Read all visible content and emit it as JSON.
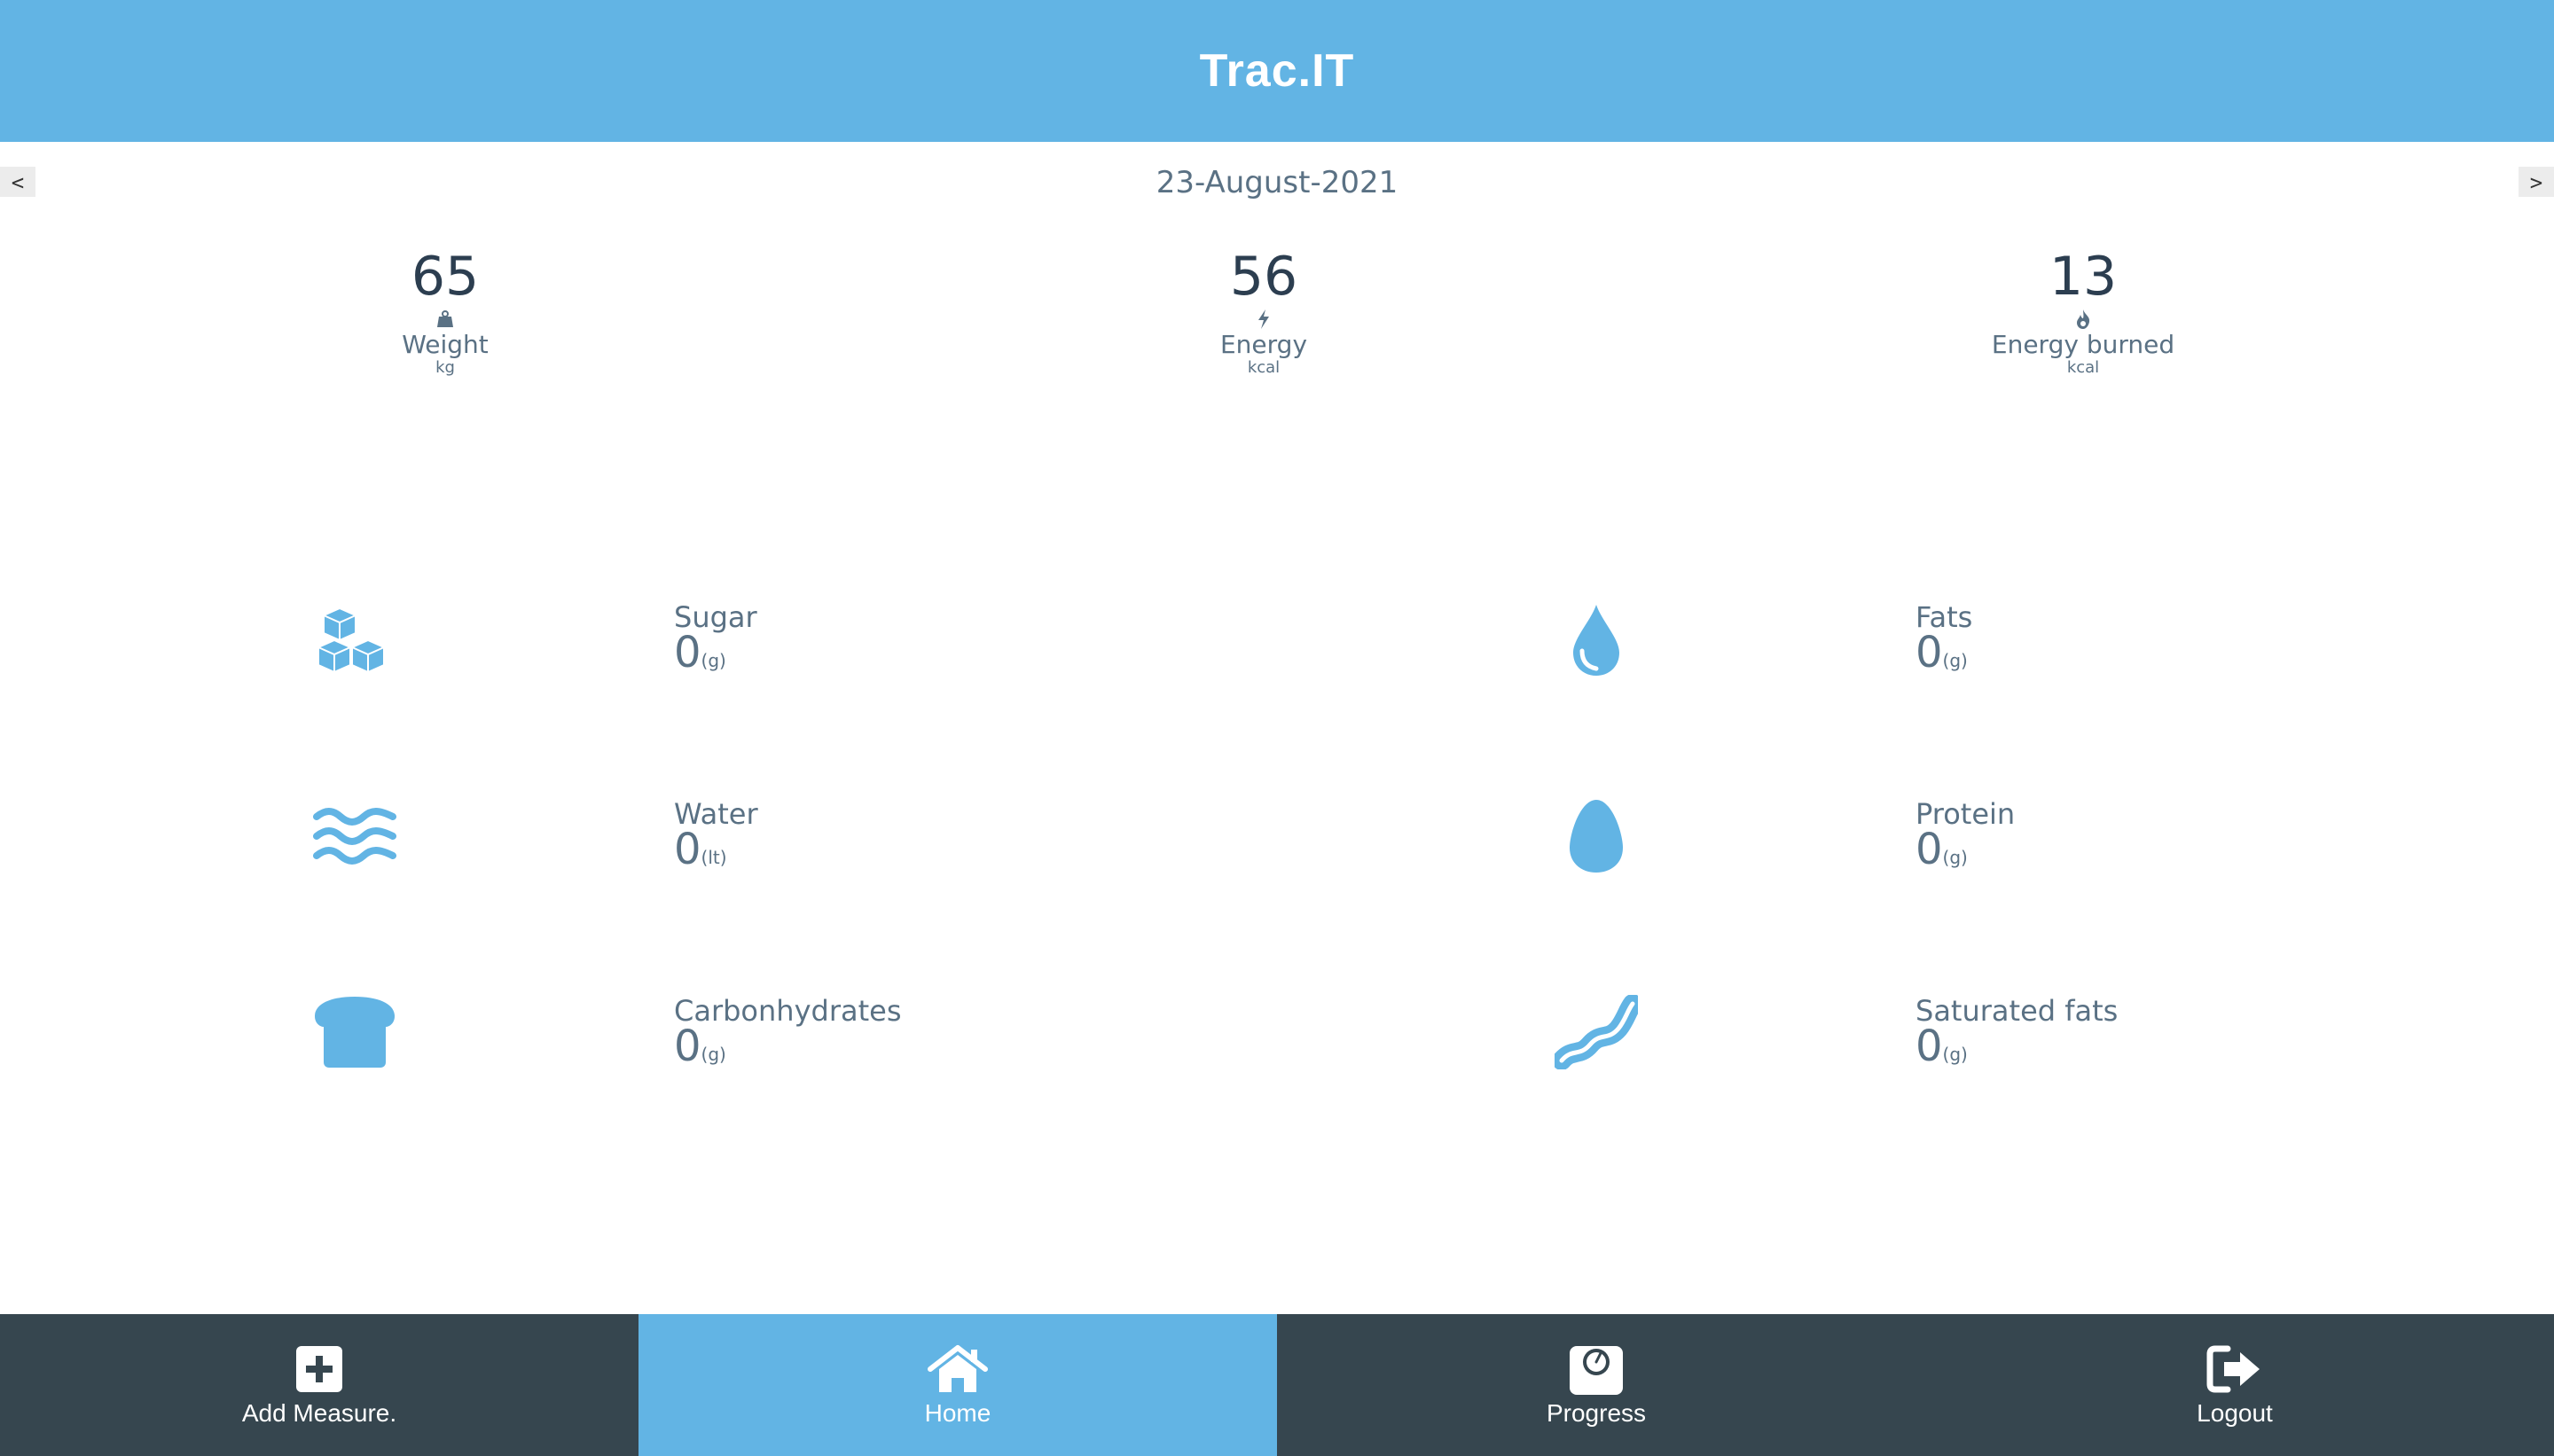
{
  "app": {
    "title": "Trac.IT"
  },
  "date_nav": {
    "prev_label": "<",
    "next_label": ">",
    "date": "23-August-2021"
  },
  "stats": [
    {
      "value": "65",
      "label": "Weight",
      "unit": "kg",
      "icon": "weight-icon"
    },
    {
      "value": "56",
      "label": "Energy",
      "unit": "kcal",
      "icon": "bolt-icon"
    },
    {
      "value": "13",
      "label": "Energy burned",
      "unit": "kcal",
      "icon": "flame-icon"
    }
  ],
  "nutrients": [
    {
      "name": "Sugar",
      "amount": "0",
      "unit": "(g)",
      "icon": "sugar-cubes-icon"
    },
    {
      "name": "Fats",
      "amount": "0",
      "unit": "(g)",
      "icon": "oil-drop-icon"
    },
    {
      "name": "Water",
      "amount": "0",
      "unit": "(lt)",
      "icon": "water-waves-icon"
    },
    {
      "name": "Protein",
      "amount": "0",
      "unit": "(g)",
      "icon": "egg-icon"
    },
    {
      "name": "Carbonhydrates",
      "amount": "0",
      "unit": "(g)",
      "icon": "bread-icon"
    },
    {
      "name": "Saturated fats",
      "amount": "0",
      "unit": "(g)",
      "icon": "bacon-icon"
    }
  ],
  "bottom_nav": [
    {
      "label": "Add Measure.",
      "icon": "plus-square-icon",
      "active": false
    },
    {
      "label": "Home",
      "icon": "home-icon",
      "active": true
    },
    {
      "label": "Progress",
      "icon": "scale-icon",
      "active": false
    },
    {
      "label": "Logout",
      "icon": "logout-icon",
      "active": false
    }
  ],
  "colors": {
    "accent": "#62b4e4",
    "nav_bg": "#36464f",
    "text": "#5a7184",
    "value_text": "#2c3e50"
  }
}
